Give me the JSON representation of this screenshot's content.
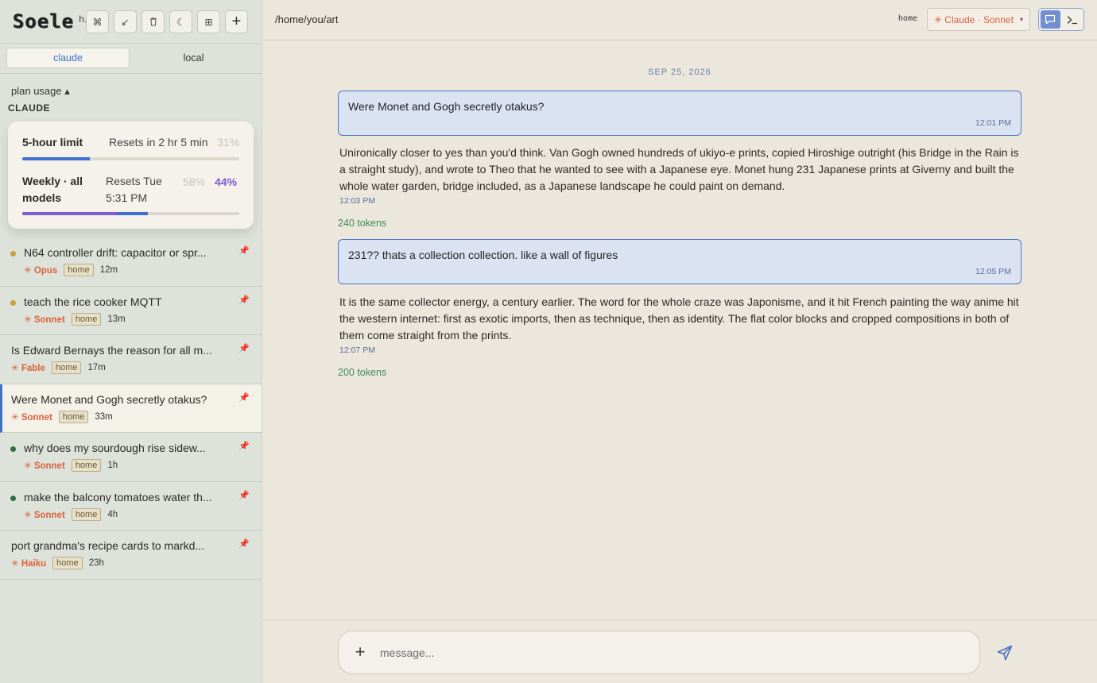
{
  "app": {
    "logo": "Soele",
    "logo_suffix": "h."
  },
  "toolbar": [
    {
      "icon": "cmd-icon",
      "glyph": "⌘"
    },
    {
      "icon": "arrow-icon",
      "glyph": "↙"
    },
    {
      "icon": "trash-icon",
      "glyph": "🗑"
    },
    {
      "icon": "moon-icon",
      "glyph": "☾"
    },
    {
      "icon": "grid-icon",
      "glyph": "⊞"
    },
    {
      "icon": "plus-icon",
      "glyph": "+"
    }
  ],
  "tabs": {
    "claude": "claude",
    "local": "local"
  },
  "usage": {
    "header": "plan usage ▴",
    "provider": "CLAUDE",
    "five_hour": {
      "label": "5-hour limit",
      "reset": "Resets in 2 hr 5 min",
      "pct": "31%",
      "fill": 0.31,
      "color": "#3f6fd0"
    },
    "weekly": {
      "label": "Weekly · all models",
      "reset": "Resets Tue 5:31 PM",
      "pct_a": "58%",
      "pct_b": "44%",
      "fill_a": 0.44,
      "fill_b": 0.58,
      "color_a": "#7b5fd0",
      "color_b": "#3f6fd0"
    }
  },
  "conversations": [
    {
      "title": "N64 controller drift: capacitor or spr...",
      "model": "✳ Opus",
      "tag": "home",
      "age": "12m",
      "dot": "#c9a133"
    },
    {
      "title": "teach the rice cooker MQTT",
      "model": "✳ Sonnet",
      "tag": "home",
      "age": "13m",
      "dot": "#c9a133"
    },
    {
      "title": "Is Edward Bernays the reason for all m...",
      "model": "✳ Fable",
      "tag": "home",
      "age": "17m",
      "dot": ""
    },
    {
      "title": "Were Monet and Gogh secretly otakus?",
      "model": "✳ Sonnet",
      "tag": "home",
      "age": "33m",
      "dot": "",
      "active": true
    },
    {
      "title": "why does my sourdough rise sidew...",
      "model": "✳ Sonnet",
      "tag": "home",
      "age": "1h",
      "dot": "#2f6e42"
    },
    {
      "title": "make the balcony tomatoes water th...",
      "model": "✳ Sonnet",
      "tag": "home",
      "age": "4h",
      "dot": "#2f6e42"
    },
    {
      "title": "port grandma's recipe cards to markd...",
      "model": "✳ Haiku",
      "tag": "home",
      "age": "23h",
      "dot": ""
    }
  ],
  "header": {
    "path": "/home/you/art",
    "env": "home",
    "model": "✳ Claude · Sonnet",
    "caret": "▾"
  },
  "chat": {
    "date": "SEP 25, 2026",
    "messages": [
      {
        "role": "user",
        "text": "Were Monet and Gogh secretly otakus?",
        "time": "12:01 PM"
      },
      {
        "role": "assistant",
        "text": "Unironically closer to yes than you'd think. Van Gogh owned hundreds of ukiyo-e prints, copied Hiroshige outright (his Bridge in the Rain is a straight study), and wrote to Theo that he wanted to see with a Japanese eye. Monet hung 231 Japanese prints at Giverny and built the whole water garden, bridge included, as a Japanese landscape he could paint on demand.",
        "time": "12:03 PM",
        "tokens": "240 tokens"
      },
      {
        "role": "user",
        "text": "231?? thats a collection collection. like a wall of figures",
        "time": "12:05 PM"
      },
      {
        "role": "assistant",
        "text": "It is the same collector energy, a century earlier. The word for the whole craze was Japonisme, and it hit French painting the way anime hit the western internet: first as exotic imports, then as technique, then as identity. The flat color blocks and cropped compositions in both of them come straight from the prints.",
        "time": "12:07 PM",
        "tokens": "200 tokens"
      }
    ]
  },
  "composer": {
    "placeholder": "message...",
    "attach": "+"
  }
}
